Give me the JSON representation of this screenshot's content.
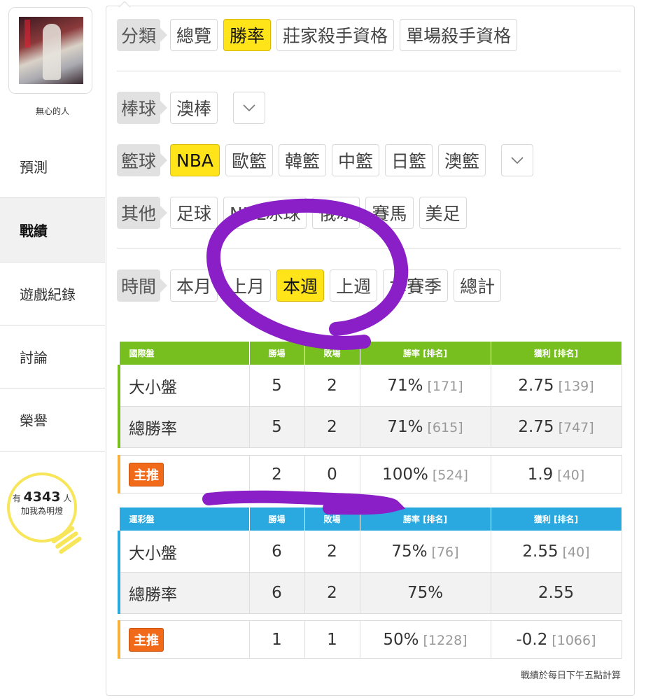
{
  "sidebar": {
    "username": "無心的人",
    "items": [
      {
        "label": "預測"
      },
      {
        "label": "戰績"
      },
      {
        "label": "遊戲紀錄"
      },
      {
        "label": "討論"
      },
      {
        "label": "榮譽"
      }
    ],
    "bulb": {
      "prefix": "有",
      "count": "4343",
      "suffix": "人",
      "line2": "加我為明燈"
    }
  },
  "filters": {
    "category": {
      "label": "分類",
      "options": [
        "總覽",
        "勝率",
        "莊家殺手資格",
        "單場殺手資格"
      ],
      "selected": "勝率"
    },
    "baseball": {
      "label": "棒球",
      "options": [
        "澳棒"
      ]
    },
    "basketball": {
      "label": "籃球",
      "options": [
        "NBA",
        "歐籃",
        "韓籃",
        "中籃",
        "日籃",
        "澳籃"
      ],
      "selected": "NBA"
    },
    "other": {
      "label": "其他",
      "options": [
        "足球",
        "NHL冰球",
        "俄冰",
        "賽馬",
        "美足"
      ]
    },
    "time": {
      "label": "時間",
      "options": [
        "本月",
        "上月",
        "本週",
        "上週",
        "本賽季",
        "總計"
      ],
      "selected": "本週"
    }
  },
  "tables": {
    "intl": {
      "headers": [
        "國際盤",
        "勝場",
        "敗場",
        "勝率 [排名]",
        "獲利 [排名]"
      ],
      "rows": [
        {
          "name": "大小盤",
          "win": "5",
          "lose": "2",
          "rate": "71%",
          "rate_rank": "[171]",
          "profit": "2.75",
          "profit_rank": "[139]"
        },
        {
          "name": "總勝率",
          "win": "5",
          "lose": "2",
          "rate": "71%",
          "rate_rank": "[615]",
          "profit": "2.75",
          "profit_rank": "[747]"
        }
      ],
      "main": {
        "badge": "主推",
        "win": "2",
        "lose": "0",
        "rate": "100%",
        "rate_rank": "[524]",
        "profit": "1.9",
        "profit_rank": "[40]"
      }
    },
    "lottery": {
      "headers": [
        "運彩盤",
        "勝場",
        "敗場",
        "勝率 [排名]",
        "獲利 [排名]"
      ],
      "rows": [
        {
          "name": "大小盤",
          "win": "6",
          "lose": "2",
          "rate": "75%",
          "rate_rank": "[76]",
          "profit": "2.55",
          "profit_rank": "[40]"
        },
        {
          "name": "總勝率",
          "win": "6",
          "lose": "2",
          "rate": "75%",
          "rate_rank": "",
          "profit": "2.55",
          "profit_rank": ""
        }
      ],
      "main": {
        "badge": "主推",
        "win": "1",
        "lose": "1",
        "rate": "50%",
        "rate_rank": "[1228]",
        "profit": "-0.2",
        "profit_rank": "[1066]"
      }
    }
  },
  "footnote": "戰績於每日下午五點計算",
  "colors": {
    "highlight": "#ffe41a",
    "green_header": "#77bf1f",
    "blue_header": "#2aa9e0",
    "badge": "#f06a1a",
    "annotation": "#8a1fc7"
  }
}
